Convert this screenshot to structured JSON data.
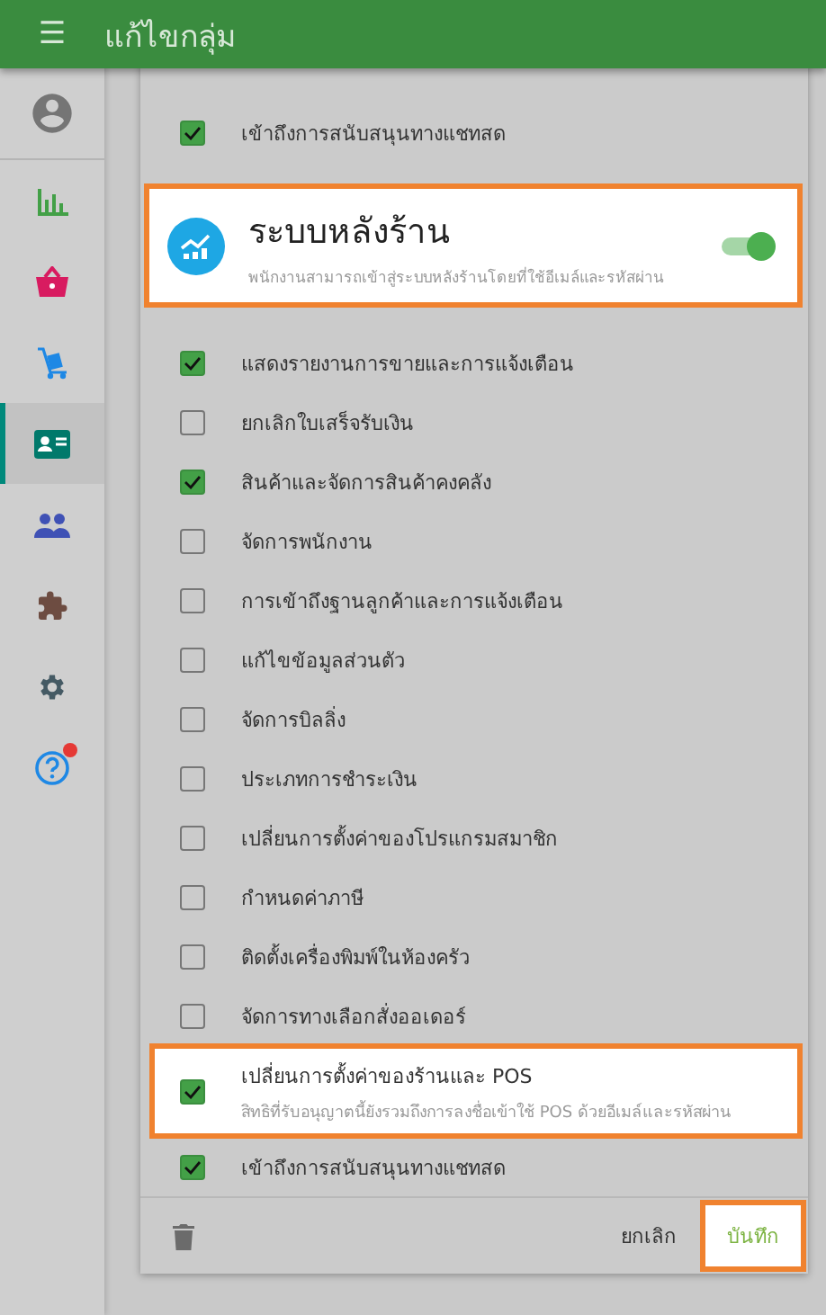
{
  "header": {
    "menu_icon": "☰",
    "title": "แก้ไขกลุ่ม"
  },
  "sidebar": {
    "items": [
      {
        "kind": "avatar",
        "selected": false,
        "badge": false
      },
      {
        "kind": "chart",
        "selected": false,
        "badge": false
      },
      {
        "kind": "basket",
        "selected": false,
        "badge": false
      },
      {
        "kind": "trolley",
        "selected": false,
        "badge": false
      },
      {
        "kind": "idcard",
        "selected": true,
        "badge": false
      },
      {
        "kind": "people",
        "selected": false,
        "badge": false
      },
      {
        "kind": "puzzle",
        "selected": false,
        "badge": false
      },
      {
        "kind": "gear",
        "selected": false,
        "badge": false
      },
      {
        "kind": "help",
        "selected": false,
        "badge": true
      }
    ]
  },
  "permissions": [
    {
      "kind": "checkbox",
      "label": "เข้าถึงการสนับสนุนทางแชทสด",
      "checked": true,
      "highlighted": false
    },
    {
      "kind": "section",
      "title": "ระบบหลังร้าน",
      "description": "พนักงานสามารถเข้าสู่ระบบหลังร้านโดยที่ใช้อีเมล์และรหัสผ่าน",
      "on": true,
      "highlighted": true
    },
    {
      "kind": "checkbox",
      "label": "แสดงรายงานการขายและการแจ้งเตือน",
      "checked": true,
      "highlighted": false
    },
    {
      "kind": "checkbox",
      "label": "ยกเลิกใบเสร็จรับเงิน",
      "checked": false,
      "highlighted": false
    },
    {
      "kind": "checkbox",
      "label": "สินค้าและจัดการสินค้าคงคลัง",
      "checked": true,
      "highlighted": false
    },
    {
      "kind": "checkbox",
      "label": "จัดการพนักงาน",
      "checked": false,
      "highlighted": false
    },
    {
      "kind": "checkbox",
      "label": "การเข้าถึงฐานลูกค้าและการแจ้งเตือน",
      "checked": false,
      "highlighted": false
    },
    {
      "kind": "checkbox",
      "label": "แก้ไขข้อมูลส่วนตัว",
      "checked": false,
      "highlighted": false
    },
    {
      "kind": "checkbox",
      "label": "จัดการบิลลิ่ง",
      "checked": false,
      "highlighted": false
    },
    {
      "kind": "checkbox",
      "label": "ประเภทการชำระเงิน",
      "checked": false,
      "highlighted": false
    },
    {
      "kind": "checkbox",
      "label": "เปลี่ยนการตั้งค่าของโปรแกรมสมาชิก",
      "checked": false,
      "highlighted": false
    },
    {
      "kind": "checkbox",
      "label": "กำหนดค่าภาษี",
      "checked": false,
      "highlighted": false
    },
    {
      "kind": "checkbox",
      "label": "ติดตั้งเครื่องพิมพ์ในห้องครัว",
      "checked": false,
      "highlighted": false
    },
    {
      "kind": "checkbox",
      "label": "จัดการทางเลือกสั่งออเดอร์",
      "checked": false,
      "highlighted": false
    },
    {
      "kind": "checkbox",
      "label": "เปลี่ยนการตั้งค่าของร้านและ POS",
      "description": "สิทธิที่รับอนุญาตนี้ยังรวมถึงการลงชื่อเข้าใช้ POS ด้วยอีเมล์และรหัสผ่าน",
      "checked": true,
      "highlighted": true
    },
    {
      "kind": "checkbox",
      "label": "เข้าถึงการสนับสนุนทางแชทสด",
      "checked": true,
      "highlighted": false
    }
  ],
  "footer": {
    "cancel": "ยกเลิก",
    "save": "บันทึก",
    "save_highlighted": true
  }
}
